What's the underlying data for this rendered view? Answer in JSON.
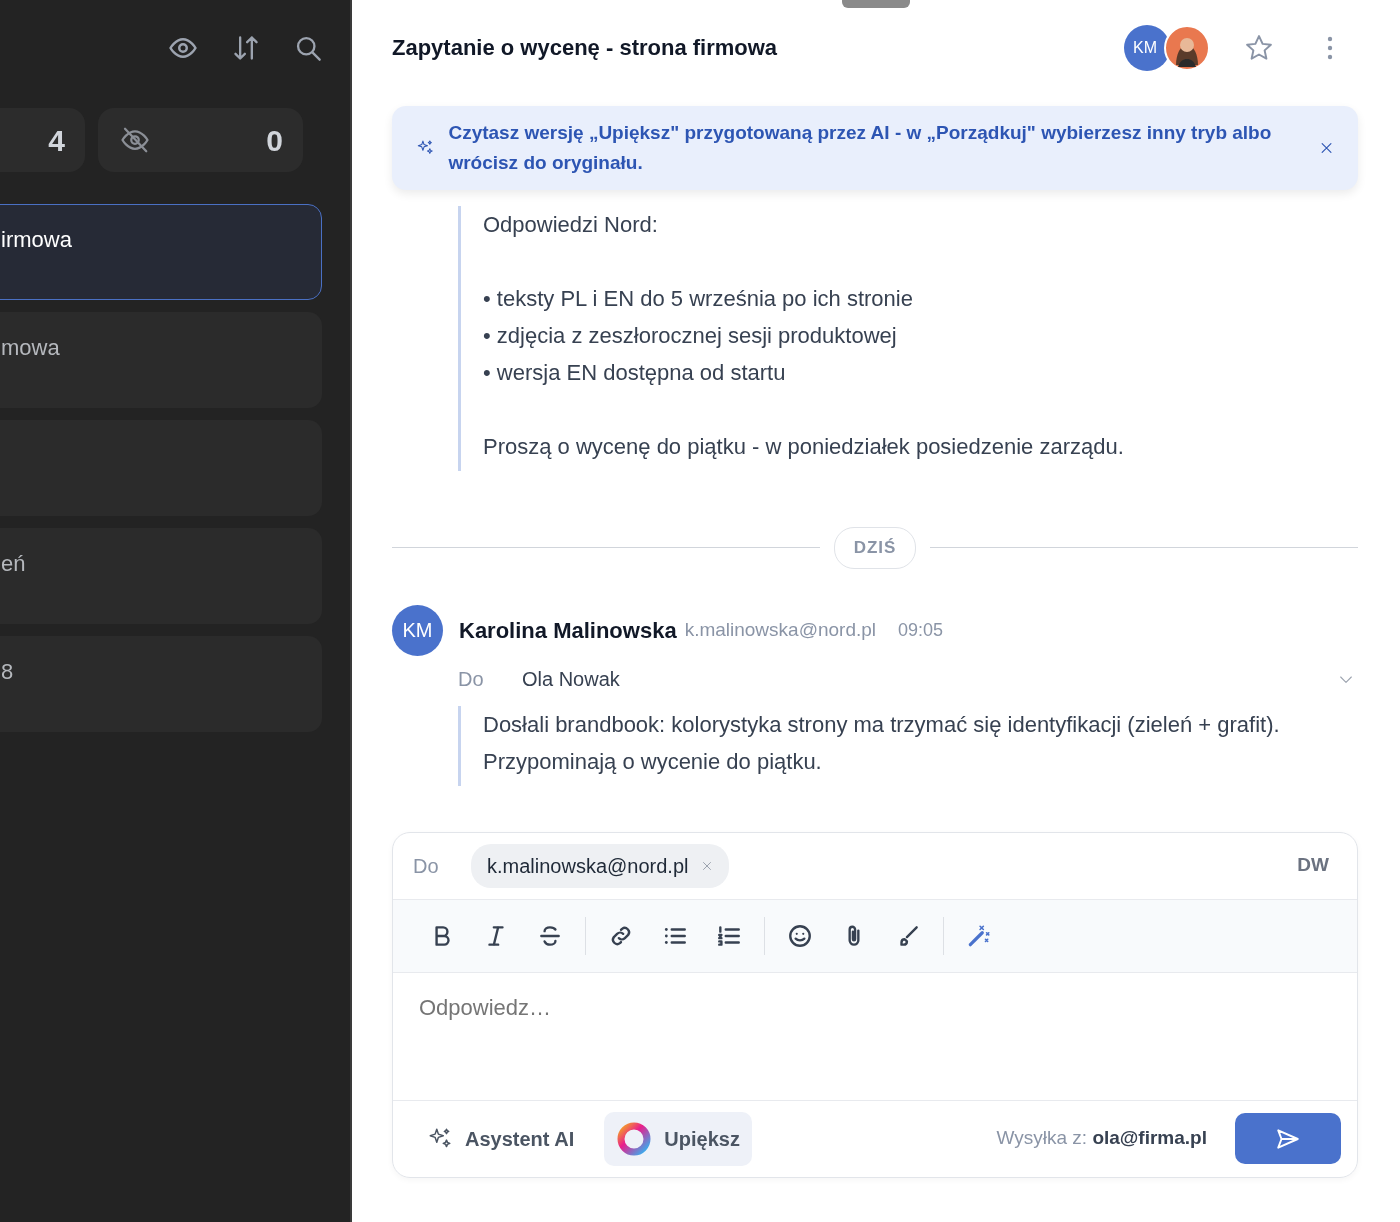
{
  "sidebar": {
    "stats": [
      {
        "value": "4",
        "kind": "plain"
      },
      {
        "value": "0",
        "kind": "hidden"
      }
    ],
    "threads": [
      {
        "title": "irmowa",
        "selected": true
      },
      {
        "title": "mowa",
        "selected": false
      },
      {
        "selected": false
      },
      {
        "title": "eń",
        "selected": false
      },
      {
        "title": "8",
        "selected": false
      }
    ]
  },
  "header": {
    "title": "Zapytanie o wycenę - strona firmowa",
    "avatars": [
      {
        "kind": "initials",
        "initials": "KM"
      },
      {
        "kind": "photo"
      }
    ],
    "starred": false
  },
  "banner": {
    "text": "Czytasz wersję „Upiększ\" przygotowaną przez AI - w „Porządkuj\" wybierzesz inny tryb albo wrócisz do oryginału."
  },
  "earlier_message": {
    "intro": "Odpowiedzi Nord:",
    "bullets": [
      "• teksty PL i EN do 5 września po ich stronie",
      "• zdjęcia z zeszłorocznej sesji produktowej",
      "• wersja EN dostępna od startu"
    ],
    "closing": "Proszą o wycenę do piątku - w poniedziałek posiedzenie zarządu."
  },
  "date_divider": "DZIŚ",
  "message": {
    "initials": "KM",
    "sender": "Karolina Malinowska",
    "email": "k.malinowska@nord.pl",
    "time": "09:05",
    "to_label": "Do",
    "to": "Ola Nowak",
    "expanded": false,
    "body": [
      "Dosłali brandbook: kolorystyka strony ma trzymać się identyfikacji (zieleń + grafit).",
      "Przypominają o wycenie do piątku."
    ]
  },
  "composer": {
    "to_label": "Do",
    "recipients": [
      "k.malinowska@nord.pl"
    ],
    "cc": "DW",
    "placeholder": "Odpowiedz…",
    "ai_button": "Asystent AI",
    "beautify_button": "Upiększ",
    "beautify_active": true,
    "from_label": "Wysyłka z:",
    "from": "ola@firma.pl"
  }
}
